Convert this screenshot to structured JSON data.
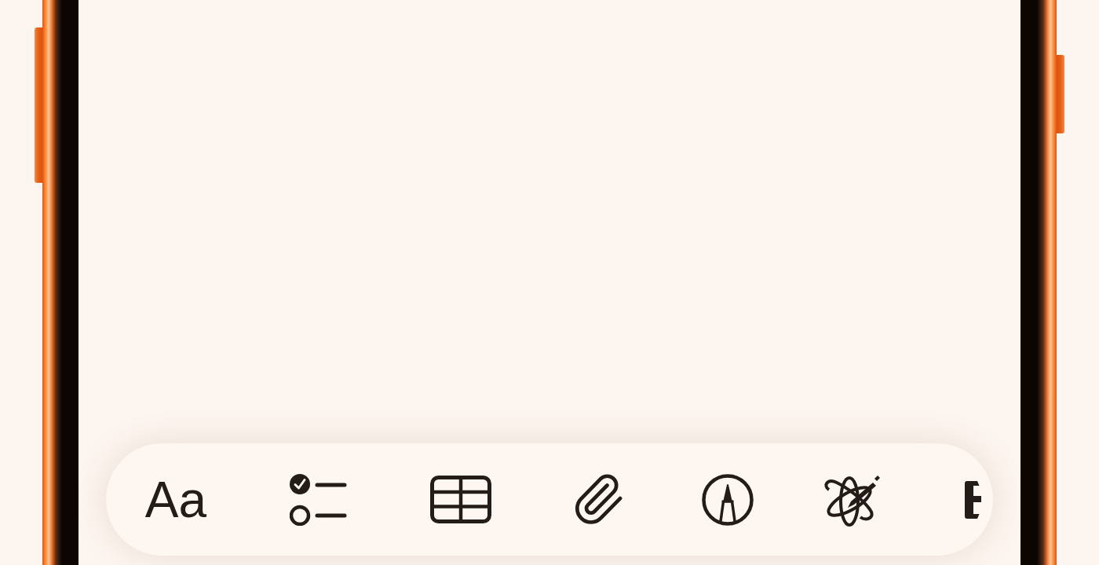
{
  "toolbar": {
    "buttons": [
      {
        "kind": "text",
        "label": "Aa"
      },
      {
        "kind": "checklist"
      },
      {
        "kind": "table"
      },
      {
        "kind": "attachment"
      },
      {
        "kind": "markup"
      },
      {
        "kind": "writing_tools"
      },
      {
        "kind": "clipped"
      }
    ]
  }
}
